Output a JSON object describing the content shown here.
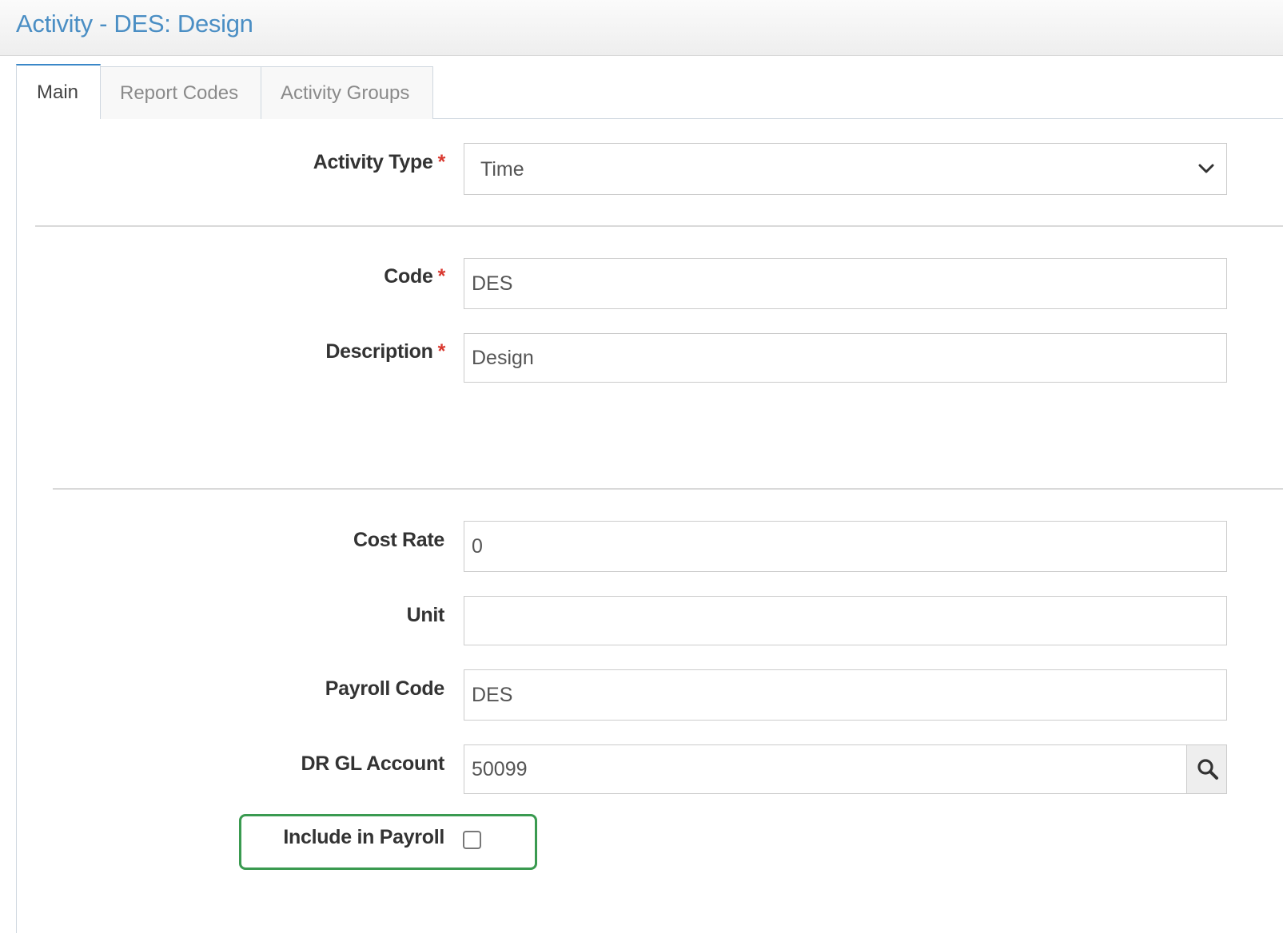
{
  "title": "Activity - DES: Design",
  "tabs": [
    {
      "label": "Main",
      "active": true
    },
    {
      "label": "Report Codes",
      "active": false
    },
    {
      "label": "Activity Groups",
      "active": false
    }
  ],
  "form": {
    "activity_type": {
      "label": "Activity Type",
      "required_mark": "*",
      "value": "Time"
    },
    "code": {
      "label": "Code",
      "required_mark": "*",
      "value": "DES"
    },
    "description": {
      "label": "Description",
      "required_mark": "*",
      "value": "Design"
    },
    "cost_rate": {
      "label": "Cost Rate",
      "value": "0"
    },
    "unit": {
      "label": "Unit",
      "value": ""
    },
    "payroll_code": {
      "label": "Payroll Code",
      "value": "DES"
    },
    "dr_gl_account": {
      "label": "DR GL Account",
      "value": "50099"
    },
    "include_in_payroll": {
      "label": "Include in Payroll",
      "checked": false
    }
  },
  "icons": {
    "select_arrow": "chevron-down-icon",
    "lookup": "search-icon"
  },
  "colors": {
    "title": "#4a8ec4",
    "required": "#d9382f",
    "active_tab_accent": "#3a87c8",
    "highlight": "#3a9a50"
  }
}
